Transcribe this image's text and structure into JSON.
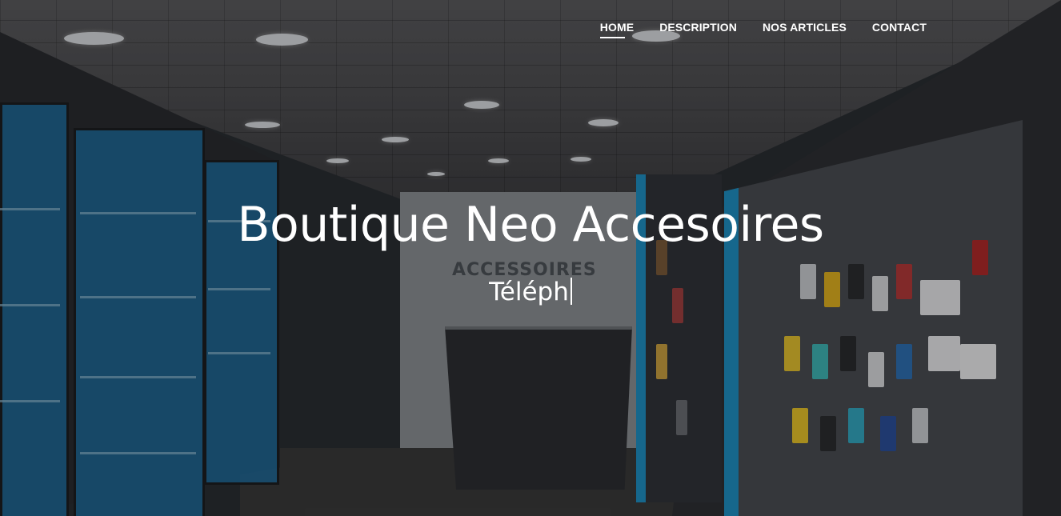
{
  "nav": {
    "items": [
      {
        "label": "HOME",
        "active": true
      },
      {
        "label": "DESCRIPTION",
        "active": false
      },
      {
        "label": "NOS ARTICLES",
        "active": false
      },
      {
        "label": "CONTACT",
        "active": false
      }
    ]
  },
  "hero": {
    "title": "Boutique Neo Accesoires",
    "typed_text": "Téléph",
    "background_sign": "ACCESSOIRES",
    "accent_color": "#1f8fc2",
    "text_color": "#ffffff"
  }
}
